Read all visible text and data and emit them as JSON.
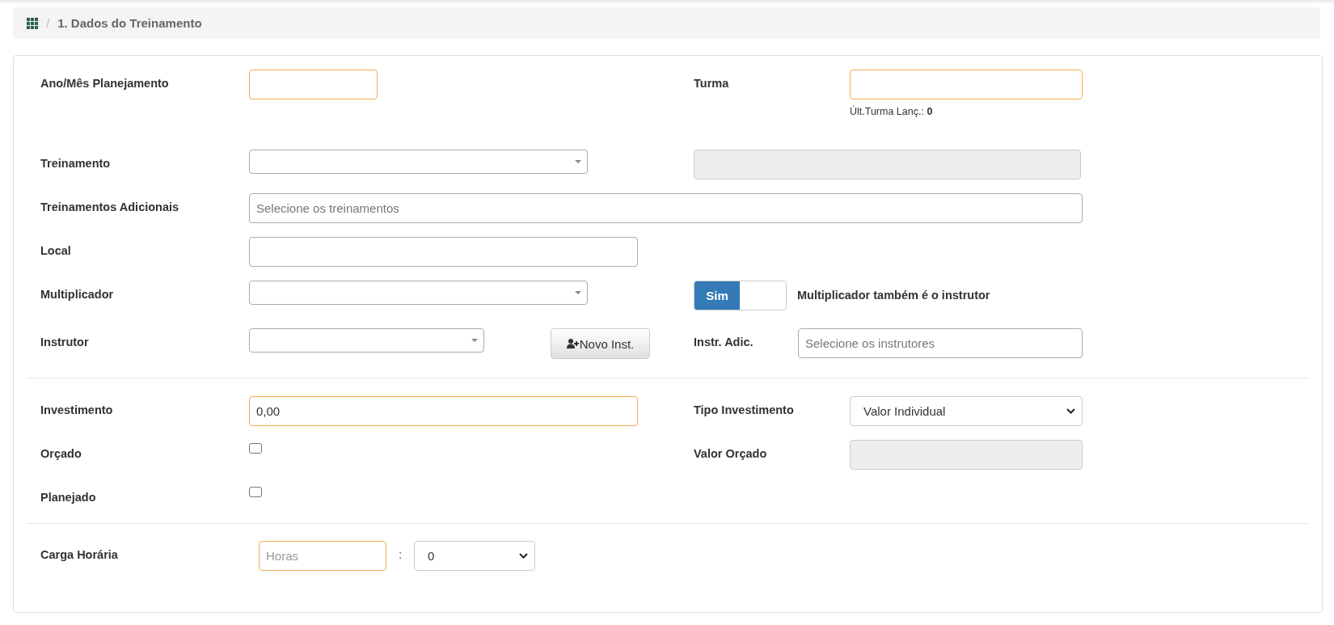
{
  "breadcrumb": {
    "separator": "/",
    "title": "1. Dados do Treinamento"
  },
  "sections": [
    {
      "rows": [
        {
          "label": "Ano/Mês Planejamento",
          "controls": [
            {
              "kind": "text",
              "highlighted": true
            }
          ],
          "right_label": "Turma",
          "right_controls": [
            {
              "kind": "text",
              "highlighted": true
            }
          ],
          "right_hint": {
            "label": "Últ.Turma Lanç.:",
            "value": "0"
          }
        },
        {
          "label": "Treinamento",
          "controls": [
            {
              "kind": "combo"
            }
          ],
          "right_controls": [
            {
              "kind": "disabled"
            }
          ]
        },
        {
          "label": "Treinamentos Adicionais",
          "controls": [
            {
              "kind": "text",
              "placeholder": "Selecione os treinamentos"
            }
          ]
        },
        {
          "label": "Local",
          "controls": [
            {
              "kind": "text"
            }
          ]
        },
        {
          "label": "Multiplicador",
          "controls": [
            {
              "kind": "combo"
            }
          ],
          "right_controls": [
            {
              "kind": "toggle",
              "on": true,
              "text": "Sim"
            },
            {
              "kind": "caption",
              "text": "Multiplicador também é o instrutor"
            }
          ]
        },
        {
          "label": "Instrutor",
          "controls": [
            {
              "kind": "combo"
            },
            {
              "kind": "button",
              "text": "Novo Inst."
            }
          ],
          "right_label": "Instr. Adic.",
          "right_controls": [
            {
              "kind": "text",
              "placeholder": "Selecione os instrutores"
            }
          ]
        }
      ]
    },
    {
      "rows": [
        {
          "label": "Investimento",
          "controls": [
            {
              "kind": "text",
              "highlighted": true,
              "value": "0,00"
            }
          ],
          "right_label": "Tipo Investimento",
          "right_controls": [
            {
              "kind": "select",
              "value": "Valor Individual"
            }
          ]
        },
        {
          "label": "Orçado",
          "controls": [
            {
              "kind": "checkbox",
              "checked": false
            }
          ],
          "right_label": "Valor Orçado",
          "right_controls": [
            {
              "kind": "disabled"
            }
          ]
        },
        {
          "label": "Planejado",
          "controls": [
            {
              "kind": "checkbox",
              "checked": false
            }
          ]
        }
      ]
    },
    {
      "rows": [
        {
          "label": "Carga Horária",
          "controls": [
            {
              "kind": "text",
              "highlighted": true,
              "placeholder": "Horas"
            },
            {
              "kind": "separator",
              "text": ":"
            },
            {
              "kind": "select",
              "value": "0"
            }
          ]
        }
      ]
    }
  ]
}
